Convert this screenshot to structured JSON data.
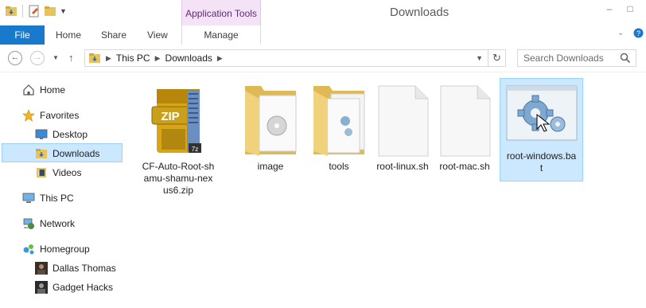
{
  "window": {
    "title": "Downloads",
    "context_tab_group": "Application Tools"
  },
  "ribbon": {
    "tabs": [
      "File",
      "Home",
      "Share",
      "View",
      "Manage"
    ]
  },
  "address": {
    "segments": [
      "This PC",
      "Downloads"
    ],
    "search_placeholder": "Search Downloads"
  },
  "nav": {
    "items": [
      {
        "label": "Home",
        "icon": "home-icon"
      },
      {
        "label": "Favorites",
        "icon": "star-icon"
      },
      {
        "label": "Desktop",
        "icon": "desktop-icon"
      },
      {
        "label": "Downloads",
        "icon": "downloads-folder-icon",
        "selected": true
      },
      {
        "label": "Videos",
        "icon": "videos-icon"
      },
      {
        "label": "This PC",
        "icon": "computer-icon"
      },
      {
        "label": "Network",
        "icon": "network-icon"
      },
      {
        "label": "Homegroup",
        "icon": "homegroup-icon"
      },
      {
        "label": "Dallas Thomas",
        "icon": "user-avatar-icon"
      },
      {
        "label": "Gadget Hacks",
        "icon": "user-avatar-icon"
      }
    ]
  },
  "files": [
    {
      "name": "CF-Auto-Root-shamu-shamu-nexus6.zip",
      "lines": [
        "CF-Auto-Root-sh",
        "amu-shamu-nex",
        "us6.zip"
      ],
      "icon": "zip-archive-icon"
    },
    {
      "name": "image",
      "lines": [
        "image"
      ],
      "icon": "folder-icon"
    },
    {
      "name": "tools",
      "lines": [
        "tools"
      ],
      "icon": "folder-icon"
    },
    {
      "name": "root-linux.sh",
      "lines": [
        "root-linux.sh"
      ],
      "icon": "blank-file-icon"
    },
    {
      "name": "root-mac.sh",
      "lines": [
        "root-mac.sh"
      ],
      "icon": "blank-file-icon"
    },
    {
      "name": "root-windows.bat",
      "lines": [
        "root-windows.ba",
        "t"
      ],
      "icon": "batch-gear-icon",
      "selected": true
    }
  ],
  "colors": {
    "file_tab": "#1979ca",
    "context_tab": "#f4e3f7",
    "selection_fill": "#cce8ff",
    "selection_border": "#99d1ff"
  }
}
